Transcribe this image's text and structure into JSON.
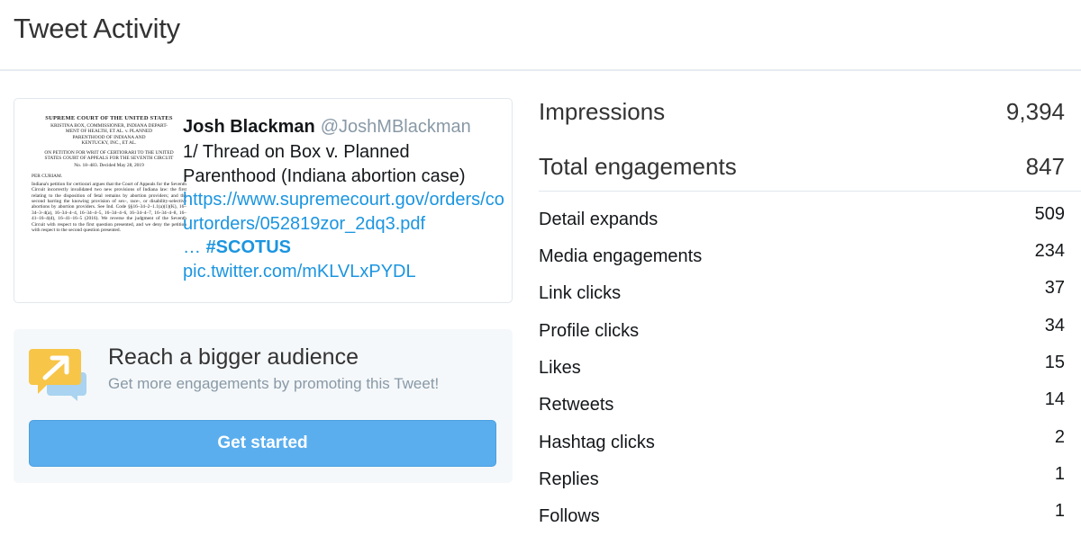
{
  "header": {
    "title": "Tweet Activity"
  },
  "tweet": {
    "name": "Josh Blackman",
    "handle": "@JoshMBlackman",
    "text": "1/ Thread on Box v. Planned Parenthood (Indiana abortion case)",
    "link": "https://www.supremecourt.gov/orders/courtorders/052819zor_2dq3.pdf",
    "ellipsis": "…",
    "hashtag": "#SCOTUS",
    "pic_link": "pic.twitter.com/mKLVLxPYDL",
    "image": {
      "court": "SUPREME COURT OF THE UNITED STATES",
      "caption_lines": [
        "KRISTINA BOX, COMMISSIONER, INDIANA DEPART-",
        "MENT OF HEALTH, ET AL. v. PLANNED",
        "PARENTHOOD OF INDIANA AND",
        "KENTUCKY, INC., ET AL."
      ],
      "petition_lines": [
        "ON PETITION FOR WRIT OF CERTIORARI TO THE UNITED",
        "STATES COURT OF APPEALS FOR THE SEVENTH CIRCUIT"
      ],
      "docket": "No. 18–483.   Decided May 28, 2019",
      "curiam": "PER CURIAM.",
      "body": "Indiana's petition for certiorari argues that the Court of Appeals for the Seventh Circuit incorrectly invalidated two new provisions of Indiana law: the first relating to the disposition of fetal remains by abortion providers; and the second barring the knowing provision of sex-, race-, or disability-selective abortions by abortion providers. See Ind. Code §§16–34–2–1.1(a)(1)(K), 16–34–3–4(a), 16–34–4–4, 16–34–4–5, 16–34–4–6, 16–34–4–7, 16–34–4–8, 16–41–16–4(d), 16–41–16–5 (2016). We reverse the judgment of the Seventh Circuit with respect to the first question presented, and we deny the petition with respect to the second question presented."
    }
  },
  "promo": {
    "title": "Reach a bigger audience",
    "subtitle": "Get more engagements by promoting this Tweet!",
    "button": "Get started",
    "icon": "promote-tweet-icon",
    "colors": {
      "icon_yellow": "#f7c548",
      "icon_blue": "#a9d3f0",
      "button": "#5aaeee"
    }
  },
  "stats": {
    "primary": [
      {
        "label": "Impressions",
        "value": "9,394"
      },
      {
        "label": "Total engagements",
        "value": "847"
      }
    ],
    "breakdown": [
      {
        "label": "Detail expands",
        "value": "509"
      },
      {
        "label": "Media engagements",
        "value": "234"
      },
      {
        "label": "Link clicks",
        "value": "37"
      },
      {
        "label": "Profile clicks",
        "value": "34"
      },
      {
        "label": "Likes",
        "value": "15"
      },
      {
        "label": "Retweets",
        "value": "14"
      },
      {
        "label": "Hashtag clicks",
        "value": "2"
      },
      {
        "label": "Replies",
        "value": "1"
      },
      {
        "label": "Follows",
        "value": "1"
      }
    ]
  }
}
